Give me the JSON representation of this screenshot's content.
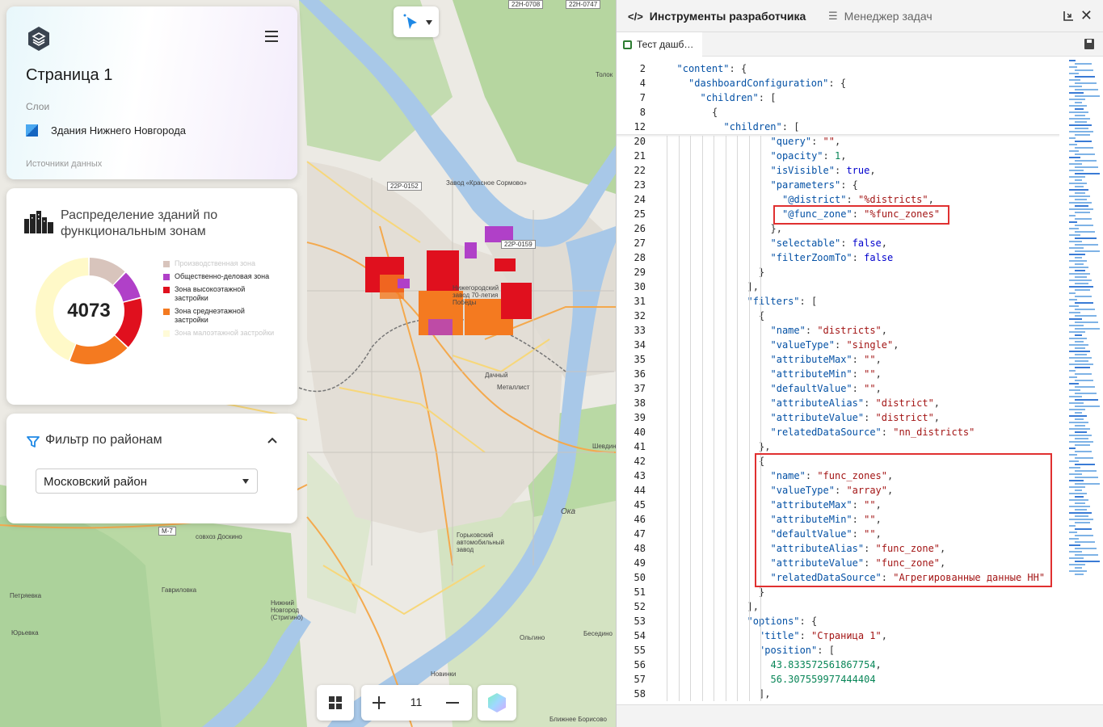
{
  "header": {
    "page_title": "Страница 1",
    "layers_label": "Слои",
    "layer_name": "Здания Нижнего Новгорода",
    "sources_label": "Источники данных"
  },
  "chart_panel": {
    "title": "Распределение зданий по функциональным зонам",
    "total": "4073"
  },
  "chart_data": {
    "type": "pie",
    "title": "Распределение зданий по функциональным зонам",
    "center_label": "4073",
    "legend_placement": "right",
    "series": [
      {
        "name": "Производственная зона",
        "value": 12,
        "color": "#d8c4bc",
        "active": false
      },
      {
        "name": "Общественно-деловая зона",
        "value": 9,
        "color": "#b040c8",
        "active": true
      },
      {
        "name": "Зона высокоэтажной застройки",
        "value": 16,
        "color": "#e0101e",
        "active": true
      },
      {
        "name": "Зона среднеэтажной застройки",
        "value": 19,
        "color": "#f47a20",
        "active": true
      },
      {
        "name": "Зона малоэтажной застройки",
        "value": 44,
        "color": "#fff9c8",
        "active": false
      }
    ]
  },
  "filter_panel": {
    "title": "Фильтр по районам",
    "selected_district": "Московский район"
  },
  "map": {
    "zoom_level": "11",
    "labels": [
      {
        "text": "Завод «Красное Сормово»",
        "color": "#555"
      },
      {
        "text": "Нижегородский завод 70-летия Победы",
        "color": "#555"
      },
      {
        "text": "Дачный",
        "color": "#333"
      },
      {
        "text": "Металлист",
        "color": "#333"
      },
      {
        "text": "Горьковский автомобильный завод",
        "color": "#555"
      },
      {
        "text": "совхоз Доскино",
        "color": "#333"
      },
      {
        "text": "Гавриловка",
        "color": "#333"
      },
      {
        "text": "Петряевка",
        "color": "#333"
      },
      {
        "text": "Юрьевка",
        "color": "#333"
      },
      {
        "text": "Нижний Новгород (Стригино)",
        "color": "#555"
      },
      {
        "text": "Ока",
        "color": "#2a5ba8"
      },
      {
        "text": "Ольгино",
        "color": "#333"
      },
      {
        "text": "Новинки",
        "color": "#333"
      },
      {
        "text": "Ближнее Борисово",
        "color": "#333"
      },
      {
        "text": "Беседино",
        "color": "#333"
      },
      {
        "text": "Толок",
        "color": "#333"
      },
      {
        "text": "Шевдин",
        "color": "#2a7a2a"
      }
    ],
    "road_badges": [
      "22Р-0152",
      "22Р-0159",
      "22Н-0708",
      "22Н-0747",
      "М-7"
    ]
  },
  "devtools": {
    "tab_devtools": "Инструменты разработчика",
    "tab_taskmgr": "Менеджер задач",
    "file_tab": "Тест дашб…",
    "code_lines": [
      {
        "n": "2",
        "indent": 1,
        "html": "<span class='k-key'>\"content\"</span>: {"
      },
      {
        "n": "4",
        "indent": 2,
        "html": "<span class='k-key'>\"dashboardConfiguration\"</span>: {"
      },
      {
        "n": "7",
        "indent": 3,
        "html": "<span class='k-key'>\"children\"</span>: ["
      },
      {
        "n": "8",
        "indent": 4,
        "html": "{"
      },
      {
        "n": "12",
        "indent": 5,
        "html": "<span class='k-key'>\"children\"</span>: ["
      },
      {
        "n": "20",
        "indent": 9,
        "html": "<span class='k-key'>\"query\"</span>: <span class='s-val'>\"\"</span>,"
      },
      {
        "n": "21",
        "indent": 9,
        "html": "<span class='k-key'>\"opacity\"</span>: <span class='num'>1</span>,"
      },
      {
        "n": "22",
        "indent": 9,
        "html": "<span class='k-key'>\"isVisible\"</span>: <span class='lit'>true</span>,"
      },
      {
        "n": "23",
        "indent": 9,
        "html": "<span class='k-key'>\"parameters\"</span>: {"
      },
      {
        "n": "24",
        "indent": 10,
        "html": "<span class='k-key'>\"@district\"</span>: <span class='s-val'>\"%districts\"</span>,"
      },
      {
        "n": "25",
        "indent": 10,
        "html": "<span class='k-key'>\"@func_zone\"</span>: <span class='s-val'>\"%func_zones\"</span>"
      },
      {
        "n": "26",
        "indent": 9,
        "html": "},"
      },
      {
        "n": "27",
        "indent": 9,
        "html": "<span class='k-key'>\"selectable\"</span>: <span class='lit'>false</span>,"
      },
      {
        "n": "28",
        "indent": 9,
        "html": "<span class='k-key'>\"filterZoomTo\"</span>: <span class='lit'>false</span>"
      },
      {
        "n": "29",
        "indent": 8,
        "html": "}"
      },
      {
        "n": "30",
        "indent": 7,
        "html": "],"
      },
      {
        "n": "31",
        "indent": 7,
        "html": "<span class='k-key'>\"filters\"</span>: ["
      },
      {
        "n": "32",
        "indent": 8,
        "html": "{"
      },
      {
        "n": "33",
        "indent": 9,
        "html": "<span class='k-key'>\"name\"</span>: <span class='s-val'>\"districts\"</span>,"
      },
      {
        "n": "34",
        "indent": 9,
        "html": "<span class='k-key'>\"valueType\"</span>: <span class='s-val'>\"single\"</span>,"
      },
      {
        "n": "35",
        "indent": 9,
        "html": "<span class='k-key'>\"attributeMax\"</span>: <span class='s-val'>\"\"</span>,"
      },
      {
        "n": "36",
        "indent": 9,
        "html": "<span class='k-key'>\"attributeMin\"</span>: <span class='s-val'>\"\"</span>,"
      },
      {
        "n": "37",
        "indent": 9,
        "html": "<span class='k-key'>\"defaultValue\"</span>: <span class='s-val'>\"\"</span>,"
      },
      {
        "n": "38",
        "indent": 9,
        "html": "<span class='k-key'>\"attributeAlias\"</span>: <span class='s-val'>\"district\"</span>,"
      },
      {
        "n": "39",
        "indent": 9,
        "html": "<span class='k-key'>\"attributeValue\"</span>: <span class='s-val'>\"district\"</span>,"
      },
      {
        "n": "40",
        "indent": 9,
        "html": "<span class='k-key'>\"relatedDataSource\"</span>: <span class='s-val'>\"nn_districts\"</span>"
      },
      {
        "n": "41",
        "indent": 8,
        "html": "},"
      },
      {
        "n": "42",
        "indent": 8,
        "html": "{"
      },
      {
        "n": "43",
        "indent": 9,
        "html": "<span class='k-key'>\"name\"</span>: <span class='s-val'>\"func_zones\"</span>,"
      },
      {
        "n": "44",
        "indent": 9,
        "html": "<span class='k-key'>\"valueType\"</span>: <span class='s-val'>\"array\"</span>,"
      },
      {
        "n": "45",
        "indent": 9,
        "html": "<span class='k-key'>\"attributeMax\"</span>: <span class='s-val'>\"\"</span>,"
      },
      {
        "n": "46",
        "indent": 9,
        "html": "<span class='k-key'>\"attributeMin\"</span>: <span class='s-val'>\"\"</span>,"
      },
      {
        "n": "47",
        "indent": 9,
        "html": "<span class='k-key'>\"defaultValue\"</span>: <span class='s-val'>\"\"</span>,"
      },
      {
        "n": "48",
        "indent": 9,
        "html": "<span class='k-key'>\"attributeAlias\"</span>: <span class='s-val'>\"func_zone\"</span>,"
      },
      {
        "n": "49",
        "indent": 9,
        "html": "<span class='k-key'>\"attributeValue\"</span>: <span class='s-val'>\"func_zone\"</span>,"
      },
      {
        "n": "50",
        "indent": 9,
        "html": "<span class='k-key'>\"relatedDataSource\"</span>: <span class='s-val'>\"Агрегированные данные НН\"</span>"
      },
      {
        "n": "51",
        "indent": 8,
        "html": "}"
      },
      {
        "n": "52",
        "indent": 7,
        "html": "],"
      },
      {
        "n": "53",
        "indent": 7,
        "html": "<span class='k-key'>\"options\"</span>: {"
      },
      {
        "n": "54",
        "indent": 8,
        "html": "<span class='k-key'>\"title\"</span>: <span class='s-val'>\"Страница 1\"</span>,"
      },
      {
        "n": "55",
        "indent": 8,
        "html": "<span class='k-key'>\"position\"</span>: ["
      },
      {
        "n": "56",
        "indent": 9,
        "html": "<span class='num'>43.833572561867754</span>,"
      },
      {
        "n": "57",
        "indent": 9,
        "html": "<span class='num'>56.307559977444404</span>"
      },
      {
        "n": "58",
        "indent": 8,
        "html": "],"
      }
    ]
  }
}
